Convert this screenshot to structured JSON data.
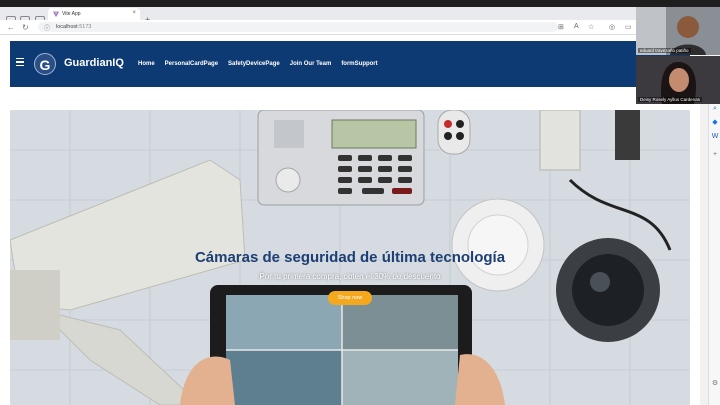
{
  "browser": {
    "tab_title": "Vite App",
    "url_host": "localhost",
    "url_port": ":5173"
  },
  "navbar": {
    "logo_letter": "G",
    "brand": "GuardianIQ",
    "links": [
      "Home",
      "PersonalCardPage",
      "SafetyDevicePage",
      "Join Our Team",
      "formSupport"
    ]
  },
  "hero": {
    "title": "Cámaras de seguridad de última tecnología",
    "subtitle": "Por tu primera compra, obten el 30% de descuento",
    "cta": "Shop now"
  },
  "keypad_screen_text": "",
  "participants": [
    {
      "name": "eduard travezaño patiño"
    },
    {
      "name": "Deisy Rosely Ayllus Cardenas"
    }
  ],
  "colors": {
    "navbar": "#0e3a73",
    "hero_title": "#1d3f73",
    "cta": "#f4a81d"
  }
}
